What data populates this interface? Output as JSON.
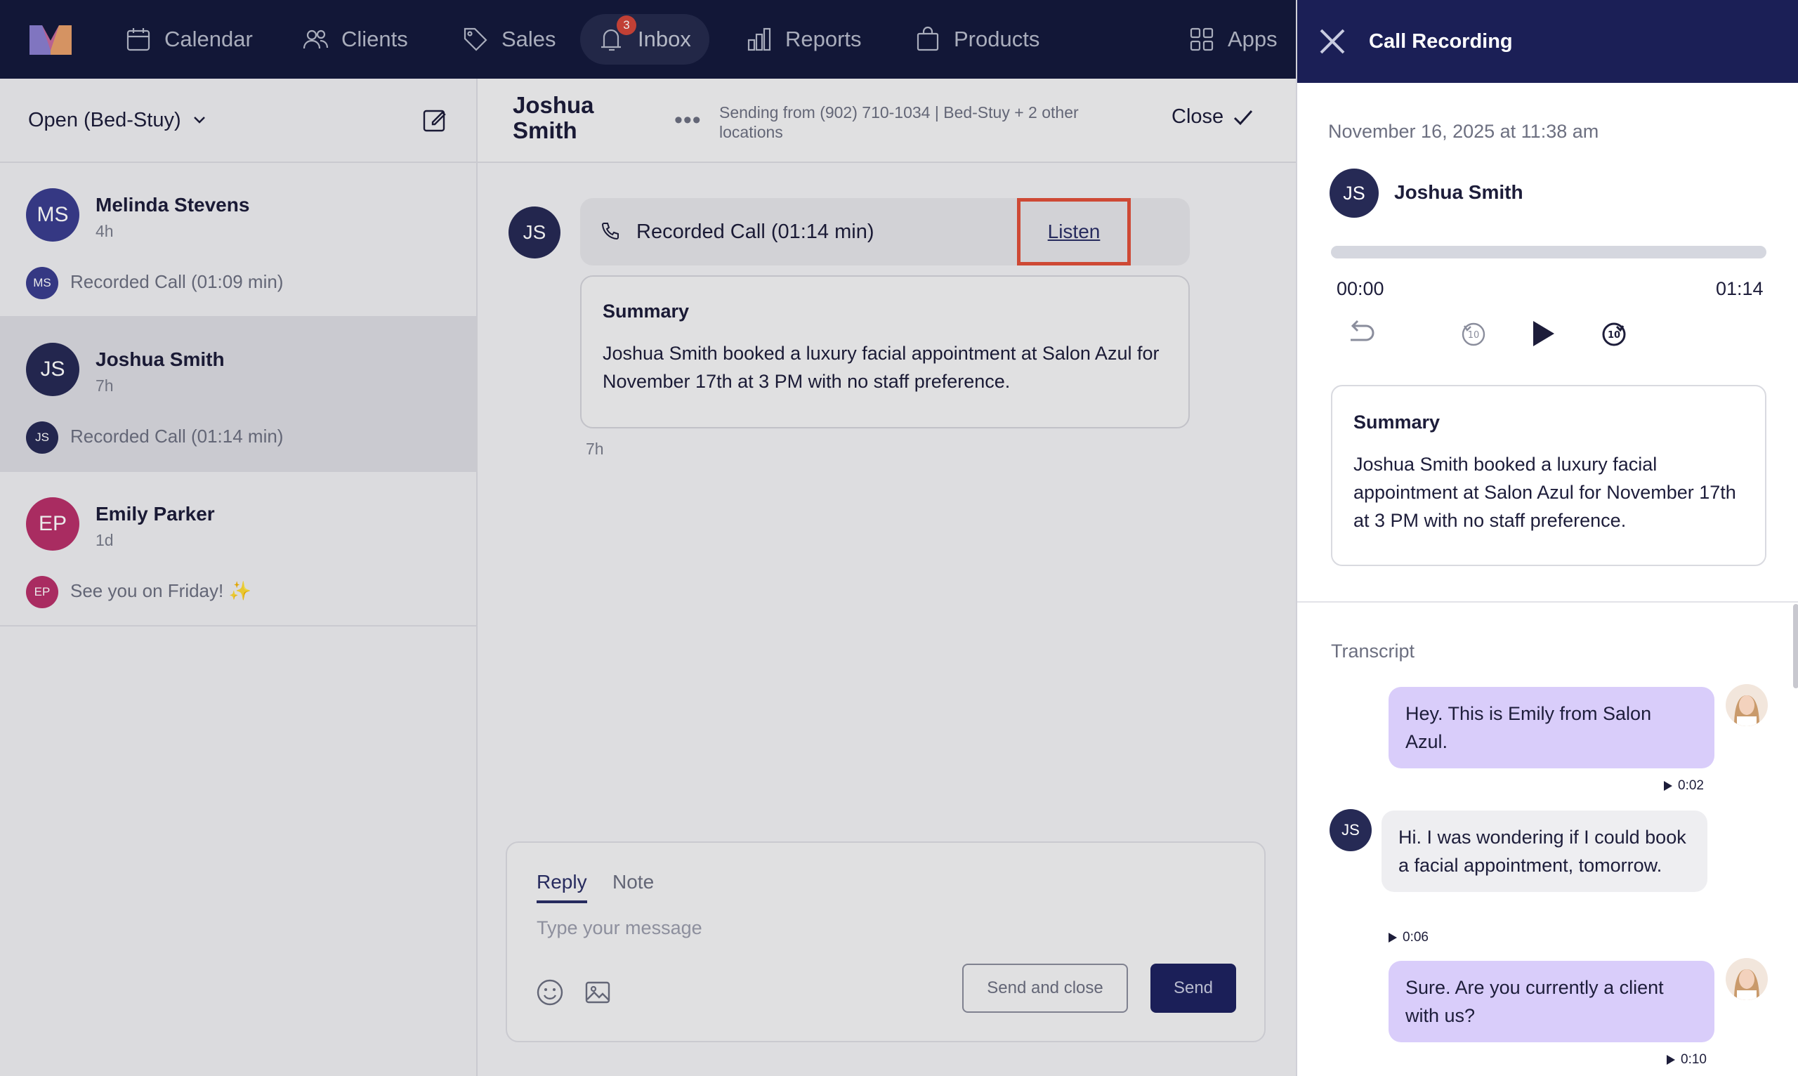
{
  "nav": {
    "items": [
      {
        "label": "Calendar",
        "icon": "calendar-icon"
      },
      {
        "label": "Clients",
        "icon": "users-icon"
      },
      {
        "label": "Sales",
        "icon": "tag-icon"
      },
      {
        "label": "Inbox",
        "icon": "inbox-icon",
        "badge": "3"
      },
      {
        "label": "Reports",
        "icon": "bar-chart-icon"
      },
      {
        "label": "Products",
        "icon": "shopping-bag-icon"
      },
      {
        "label": "Apps",
        "icon": "grid-icon"
      }
    ]
  },
  "list": {
    "filter": "Open (Bed-Stuy)",
    "conversations": [
      {
        "initials": "MS",
        "name": "Melinda Stevens",
        "time": "4h",
        "preview": "Recorded Call (01:09 min)",
        "color": "#3a3d8f"
      },
      {
        "initials": "JS",
        "name": "Joshua Smith",
        "time": "7h",
        "preview": "Recorded Call (01:14 min)",
        "color": "#262a55"
      },
      {
        "initials": "EP",
        "name": "Emily Parker",
        "time": "1d",
        "preview": "See you on Friday! ✨",
        "color": "#b8306a"
      }
    ]
  },
  "conversation": {
    "name": "Joshua Smith",
    "sending_from": "Sending from (902) 710-1034 | Bed-Stuy + 2 other locations",
    "close_label": "Close",
    "avatar_initials": "JS",
    "call_label": "Recorded Call (01:14 min)",
    "listen_label": "Listen",
    "summary_title": "Summary",
    "summary_text": "Joshua Smith booked a luxury facial appointment at Salon Azul for November 17th at 3 PM with no staff preference.",
    "message_time": "7h"
  },
  "reply": {
    "tab_reply": "Reply",
    "tab_note": "Note",
    "placeholder": "Type your message",
    "send_and_close": "Send and close",
    "send": "Send"
  },
  "drawer": {
    "title": "Call Recording",
    "date": "November 16, 2025 at 11:38 am",
    "avatar_initials": "JS",
    "name": "Joshua Smith",
    "time_start": "00:00",
    "time_end": "01:14",
    "progress": 0,
    "summary_title": "Summary",
    "summary_text": "Joshua Smith booked a luxury facial appointment at Salon Azul for November 17th at 3 PM with no staff preference.",
    "transcript_label": "Transcript",
    "transcript": [
      {
        "speaker": "agent",
        "text": "Hey. This is Emily from Salon Azul.",
        "time": "0:02"
      },
      {
        "speaker": "client",
        "initials": "JS",
        "text": "Hi. I was wondering if I could book a facial appointment, tomorrow.",
        "time": "0:06"
      },
      {
        "speaker": "agent",
        "text": "Sure. Are you currently a client with us?",
        "time": "0:10"
      }
    ]
  },
  "colors": {
    "nav_bg": "#141a3c",
    "drawer_header": "#1b1f56",
    "accent_highlight": "#e0503a",
    "agent_bubble": "#d9cdfa",
    "primary_button": "#1e2260"
  }
}
